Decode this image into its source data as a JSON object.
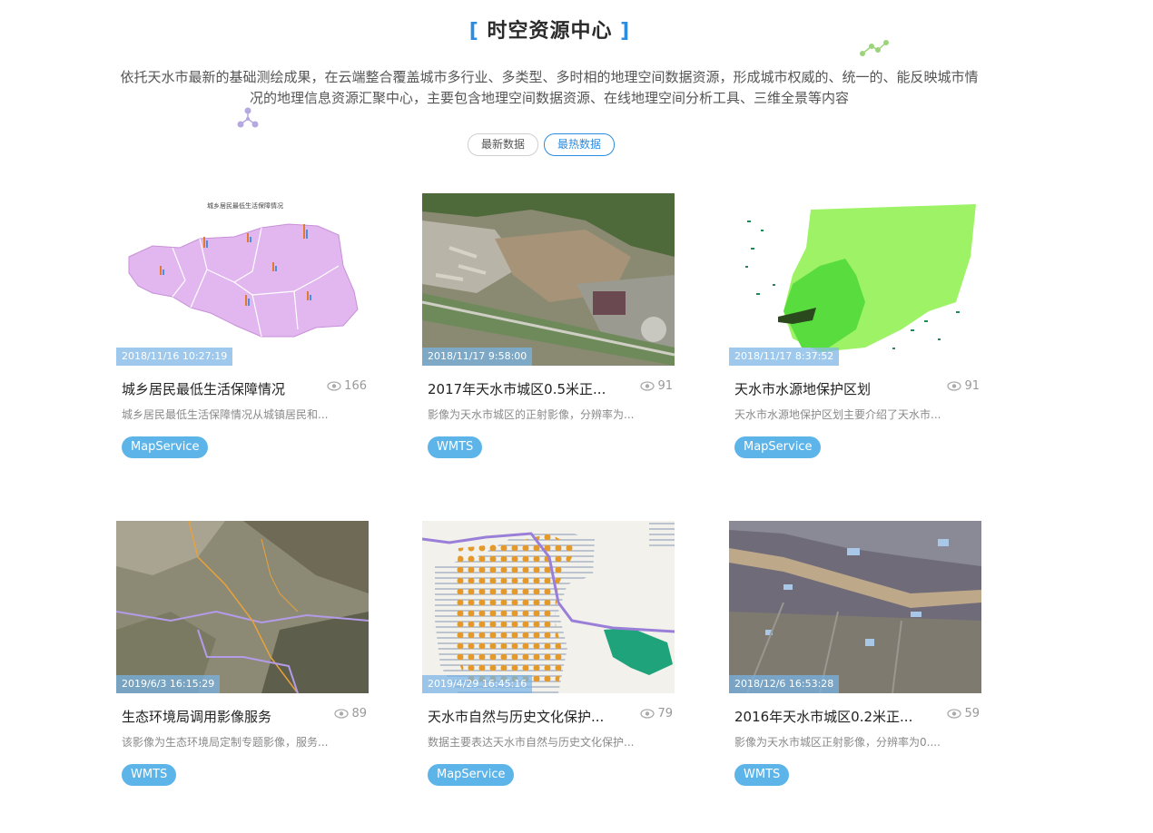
{
  "header": {
    "title": "时空资源中心",
    "bracket_left": "[",
    "bracket_right": "]",
    "description": "依托天水市最新的基础测绘成果，在云端整合覆盖城市多行业、多类型、多时相的地理空间数据资源，形成城市权威的、统一的、能反映城市情况的地理信息资源汇聚中心，主要包含地理空间数据资源、在线地理空间分析工具、三维全景等内容"
  },
  "tabs": [
    {
      "label": "最新数据",
      "active": false
    },
    {
      "label": "最热数据",
      "active": true
    }
  ],
  "cards": [
    {
      "timestamp": "2018/11/16 10:27:19",
      "title": "城乡居民最低生活保障情况",
      "views": "166",
      "desc": "城乡居民最低生活保障情况从城镇居民和...",
      "tag": "MapService",
      "thumb": "choropleth-map",
      "map_title": "城乡居民最低生活保障情况"
    },
    {
      "timestamp": "2018/11/17 9:58:00",
      "title": "2017年天水市城区0.5米正...",
      "views": "91",
      "desc": "影像为天水市城区的正射影像，分辨率为...",
      "tag": "WMTS",
      "thumb": "satellite-image"
    },
    {
      "timestamp": "2018/11/17 8:37:52",
      "title": "天水市水源地保护区划",
      "views": "91",
      "desc": "天水市水源地保护区划主要介绍了天水市...",
      "tag": "MapService",
      "thumb": "water-protection-map"
    },
    {
      "timestamp": "2019/6/3 16:15:29",
      "title": "生态环境局调用影像服务",
      "views": "89",
      "desc": "该影像为生态环境局定制专题影像，服务...",
      "tag": "WMTS",
      "thumb": "terrain-image"
    },
    {
      "timestamp": "2019/4/29 16:45:16",
      "title": "天水市自然与历史文化保护...",
      "views": "79",
      "desc": "数据主要表达天水市自然与历史文化保护...",
      "tag": "MapService",
      "thumb": "heritage-map"
    },
    {
      "timestamp": "2018/12/6 16:53:28",
      "title": "2016年天水市城区0.2米正...",
      "views": "59",
      "desc": "影像为天水市城区正射影像，分辨率为0....",
      "tag": "WMTS",
      "thumb": "urban-image"
    }
  ],
  "colors": {
    "accent": "#2b8ce0",
    "badge": "#5db4e8",
    "timestamp_bg": "#78b4e6"
  }
}
